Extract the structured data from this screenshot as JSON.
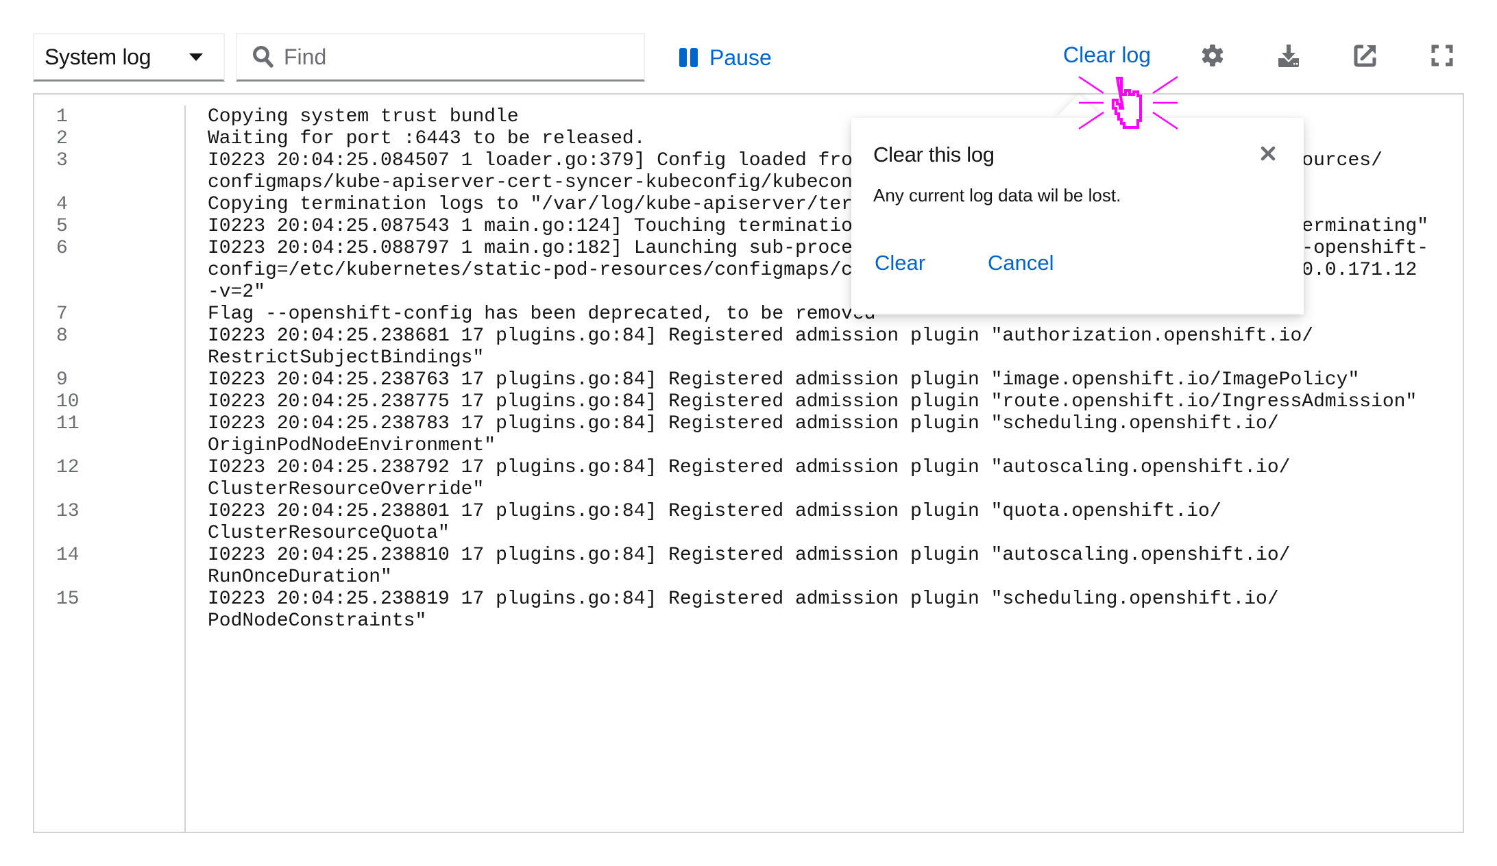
{
  "toolbar": {
    "log_select": {
      "selected": "System log"
    },
    "find": {
      "placeholder": "Find",
      "value": ""
    },
    "pause_label": "Pause",
    "clear_log_label": "Clear log",
    "icons": [
      "settings-icon",
      "download-icon",
      "external-link-icon",
      "fullscreen-icon"
    ]
  },
  "colors": {
    "link": "#0066cc",
    "text": "#151515",
    "muted": "#6a6e73",
    "border": "#d2d2d2",
    "cursor_highlight": "#ff00ff"
  },
  "log": {
    "lines": [
      {
        "number": "1",
        "rows": [
          "Copying system trust bundle"
        ]
      },
      {
        "number": "2",
        "rows": [
          "Waiting for port :6443 to be released."
        ]
      },
      {
        "number": "3",
        "rows": [
          "I0223 20:04:25.084507 1 loader.go:379] Config loaded from file:  /etc/kubernetes/static-pod-resources/",
          "configmaps/kube-apiserver-cert-syncer-kubeconfig/kubeconfig"
        ]
      },
      {
        "number": "4",
        "rows": [
          "Copying termination logs to \"/var/log/kube-apiserver/termination.log\""
        ]
      },
      {
        "number": "5",
        "rows": [
          "I0223 20:04:25.087543 1 main.go:124] Touching termination lock file \"/var/log/kube-apiserver/.terminating\""
        ]
      },
      {
        "number": "6",
        "rows": [
          "I0223 20:04:25.088797 1 main.go:182] Launching sub-process \"/usr/bin/hyperkube kube-apiserver --openshift-",
          "config=/etc/kubernetes/static-pod-resources/configmaps/config/config.yaml --advertise-address=10.0.171.12",
          "-v=2\""
        ]
      },
      {
        "number": "7",
        "rows": [
          "Flag --openshift-config has been deprecated, to be removed"
        ]
      },
      {
        "number": "8",
        "rows": [
          "I0223 20:04:25.238681 17 plugins.go:84] Registered admission plugin \"authorization.openshift.io/",
          "RestrictSubjectBindings\""
        ]
      },
      {
        "number": "9",
        "rows": [
          "I0223 20:04:25.238763 17 plugins.go:84] Registered admission plugin \"image.openshift.io/ImagePolicy\""
        ]
      },
      {
        "number": "10",
        "rows": [
          "I0223 20:04:25.238775 17 plugins.go:84] Registered admission plugin \"route.openshift.io/IngressAdmission\""
        ]
      },
      {
        "number": "11",
        "rows": [
          "I0223 20:04:25.238783 17 plugins.go:84] Registered admission plugin \"scheduling.openshift.io/",
          "OriginPodNodeEnvironment\""
        ]
      },
      {
        "number": "12",
        "rows": [
          "I0223 20:04:25.238792 17 plugins.go:84] Registered admission plugin \"autoscaling.openshift.io/",
          "ClusterResourceOverride\""
        ]
      },
      {
        "number": "13",
        "rows": [
          "I0223 20:04:25.238801 17 plugins.go:84] Registered admission plugin \"quota.openshift.io/",
          "ClusterResourceQuota\""
        ]
      },
      {
        "number": "14",
        "rows": [
          "I0223 20:04:25.238810 17 plugins.go:84] Registered admission plugin \"autoscaling.openshift.io/",
          "RunOnceDuration\""
        ]
      },
      {
        "number": "15",
        "rows": [
          "I0223 20:04:25.238819 17 plugins.go:84] Registered admission plugin \"scheduling.openshift.io/",
          "PodNodeConstraints\""
        ]
      }
    ]
  },
  "popover": {
    "title": "Clear this log",
    "body": "Any current log data wil be lost.",
    "confirm_label": "Clear",
    "cancel_label": "Cancel"
  }
}
